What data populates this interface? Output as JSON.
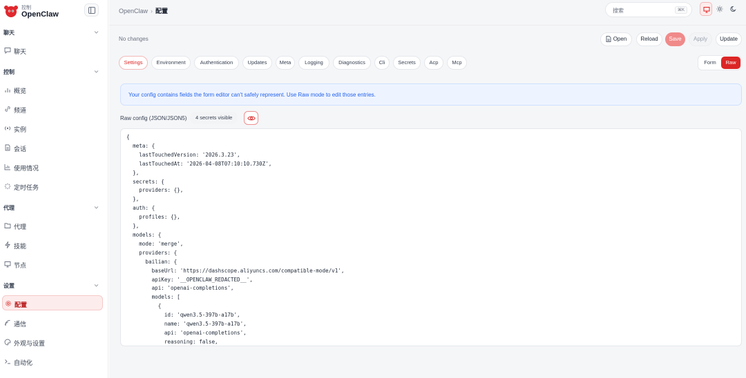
{
  "brand": {
    "subtitle": "控制",
    "title": "OpenClaw"
  },
  "sidebar": {
    "sections": [
      {
        "label": "聊天",
        "items": [
          {
            "label": "聊天",
            "icon": "chat-icon"
          }
        ]
      },
      {
        "label": "控制",
        "items": [
          {
            "label": "概览",
            "icon": "bar-chart-icon"
          },
          {
            "label": "频道",
            "icon": "link-icon"
          },
          {
            "label": "实例",
            "icon": "radio-icon"
          },
          {
            "label": "会话",
            "icon": "document-icon"
          },
          {
            "label": "使用情况",
            "icon": "chart-icon"
          },
          {
            "label": "定时任务",
            "icon": "loader-icon"
          }
        ]
      },
      {
        "label": "代理",
        "items": [
          {
            "label": "代理",
            "icon": "folder-icon"
          },
          {
            "label": "技能",
            "icon": "bolt-icon"
          },
          {
            "label": "节点",
            "icon": "monitor-icon"
          }
        ]
      },
      {
        "label": "设置",
        "items": [
          {
            "label": "配置",
            "icon": "gear-icon",
            "active": true
          },
          {
            "label": "通信",
            "icon": "signal-icon"
          },
          {
            "label": "外观与设置",
            "icon": "palette-icon"
          },
          {
            "label": "自动化",
            "icon": "terminal-icon"
          }
        ]
      }
    ]
  },
  "breadcrumb": {
    "root": "OpenClaw",
    "separator": "›",
    "current": "配置"
  },
  "search": {
    "placeholder": "搜索",
    "shortcut": "⌘K"
  },
  "status": {
    "changes": "No changes"
  },
  "actions": {
    "open": "Open",
    "reload": "Reload",
    "save": "Save",
    "apply": "Apply",
    "update": "Update"
  },
  "tabs": [
    "Settings",
    "Environment",
    "Authentication",
    "Updates",
    "Meta",
    "Logging",
    "Diagnostics",
    "Cli",
    "Secrets",
    "Acp",
    "Mcp"
  ],
  "active_tab": "Settings",
  "mode": {
    "form": "Form",
    "raw": "Raw",
    "active": "Raw"
  },
  "notice": "Your config contains fields the form editor can't safely represent. Use Raw mode to edit those entries.",
  "raw": {
    "label": "Raw config (JSON/JSON5)",
    "secrets_badge": "4 secrets visible"
  },
  "editor_text": "{\n  meta: {\n    lastTouchedVersion: '2026.3.23',\n    lastTouchedAt: '2026-04-08T07:10:10.730Z',\n  },\n  secrets: {\n    providers: {},\n  },\n  auth: {\n    profiles: {},\n  },\n  models: {\n    mode: 'merge',\n    providers: {\n      bailian: {\n        baseUrl: 'https://dashscope.aliyuncs.com/compatible-mode/v1',\n        apiKey: '__OPENCLAW_REDACTED__',\n        api: 'openai-completions',\n        models: [\n          {\n            id: 'qwen3.5-397b-a17b',\n            name: 'qwen3.5-397b-a17b',\n            api: 'openai-completions',\n            reasoning: false,\n            input: [",
  "colors": {
    "accent": "#dc2626",
    "accent_soft": "#fdecec",
    "notice_text": "#2563eb",
    "notice_bg": "#eef4ff"
  }
}
